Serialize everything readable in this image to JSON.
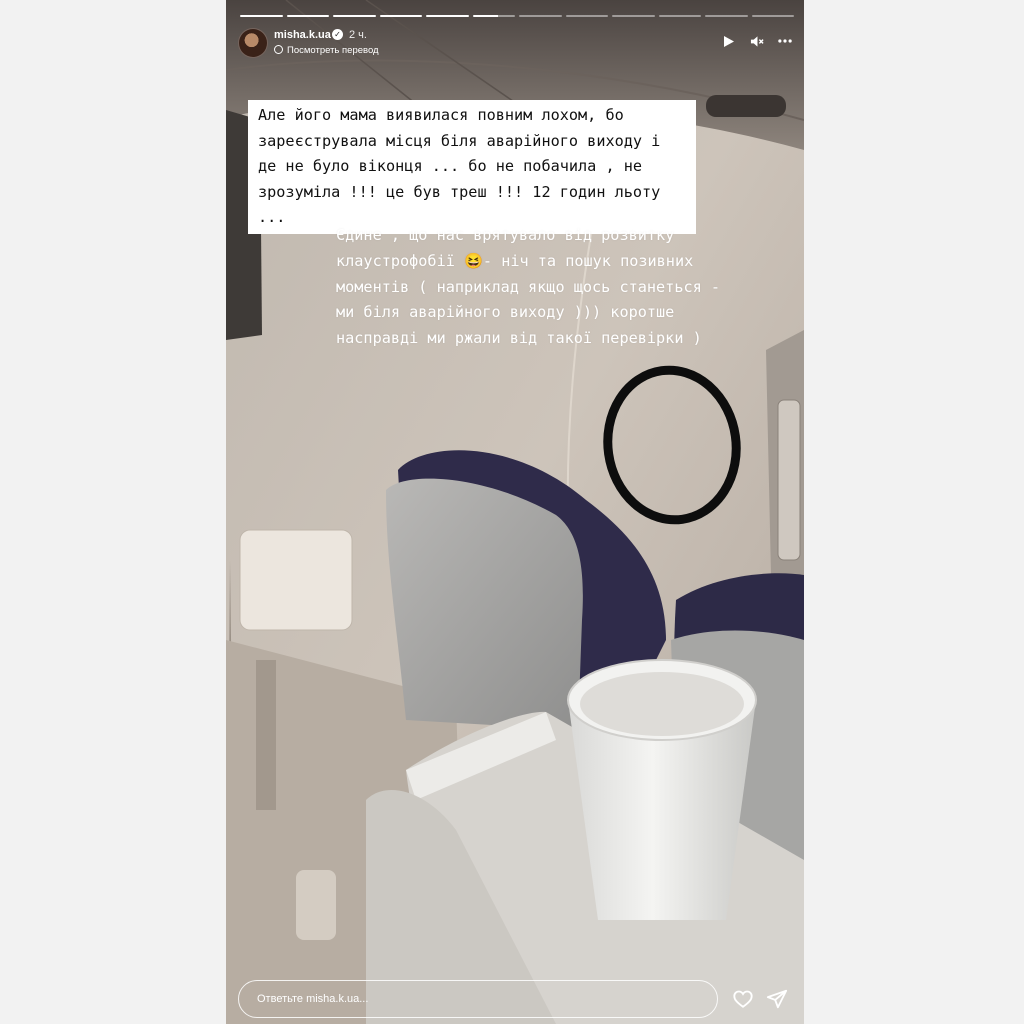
{
  "story": {
    "progress": {
      "total_segments": 12,
      "completed_segments": 5,
      "current_segment": 6,
      "current_fill": 0.6
    },
    "header": {
      "username": "misha.k.ua",
      "time_ago": "2 ч.",
      "translate_label": "Посмотреть перевод"
    },
    "controls": [
      "play-icon",
      "mute-icon",
      "more-icon"
    ],
    "caption_white_box": [
      "Але його мама виявилася повним лохом, бо",
      "зареєструвала місця біля аварійного виходу і",
      "де не було віконця ... бо не побачила , не",
      "зрозуміла !!! це був треш !!! 12 годин льоту ..."
    ],
    "caption_plain": [
      "Єдине , що нас врятувало від розвитку",
      "клаустрофобії 😆- ніч та пошук позивних",
      "моментів ( наприклад якщо щось станеться -",
      "ми біля аварійного виходу ))) коротше",
      "насправді ми ржали від такої перевірки )"
    ],
    "reply": {
      "placeholder": "Ответьте misha.k.ua..."
    },
    "icons": {
      "like": "heart-icon",
      "share": "send-icon"
    }
  }
}
